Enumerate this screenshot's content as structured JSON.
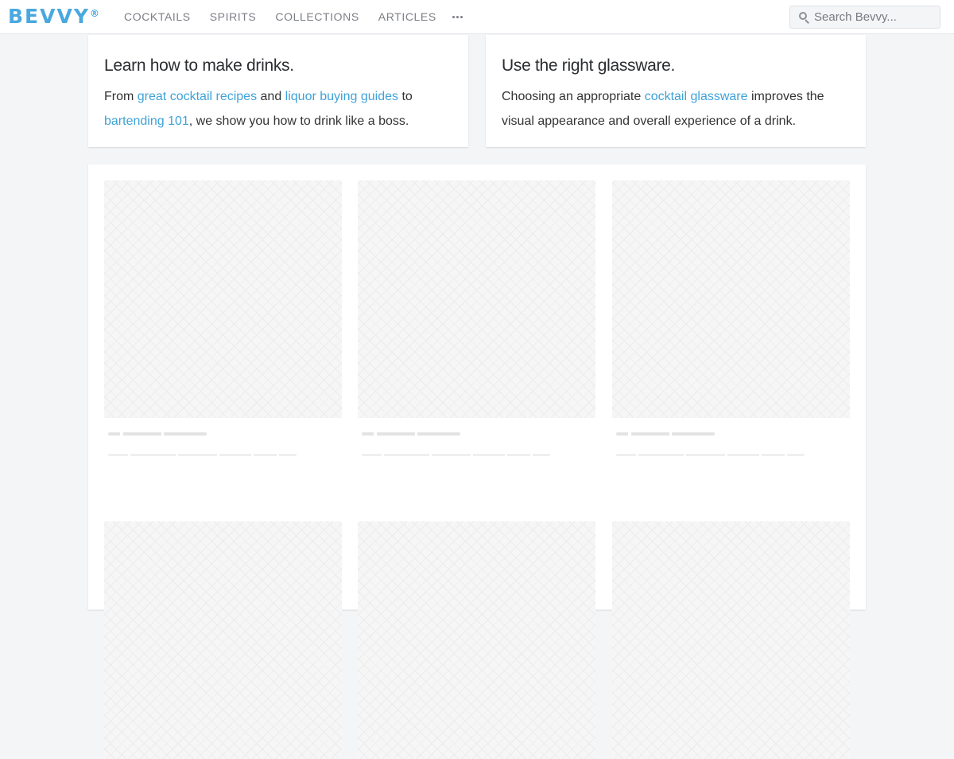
{
  "header": {
    "logo": "BEVVY",
    "logo_mark": "®",
    "nav": [
      "COCKTAILS",
      "SPIRITS",
      "COLLECTIONS",
      "ARTICLES"
    ],
    "more_icon": "ellipsis-icon",
    "search_placeholder": "Search Bevvy...",
    "search_icon": "search-icon"
  },
  "cards": [
    {
      "title": "Learn how to make drinks.",
      "t1": "From ",
      "l1": "great cocktail recipes",
      "t2": " and ",
      "l2": "liquor buying guides",
      "t3": " to ",
      "l3": "bartending 101",
      "t4": ", we show you how to drink like a boss."
    },
    {
      "title": "Use the right glassware.",
      "t1": "Choosing an appropriate ",
      "l1": "cocktail glassware",
      "t2": " improves the visual appearance and overall experience of a drink."
    }
  ],
  "colors": {
    "brand": "#4aa8df",
    "link": "#3ea2d8",
    "background": "#f4f5f7"
  }
}
